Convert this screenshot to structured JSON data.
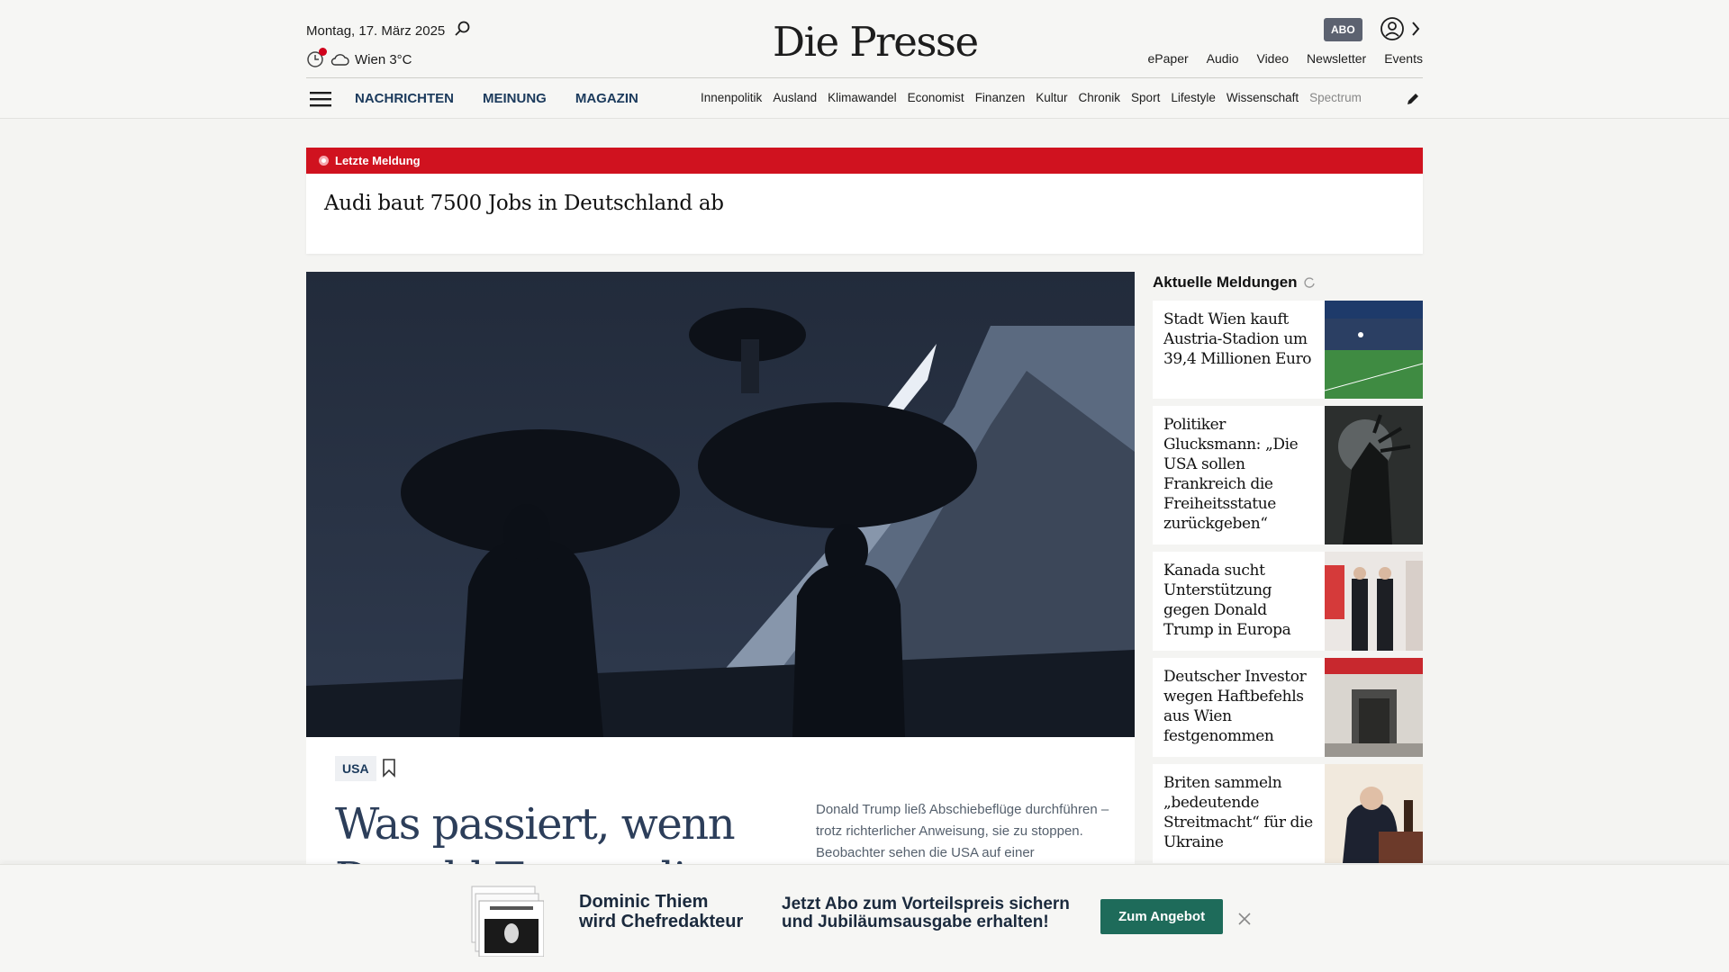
{
  "header": {
    "date": "Montag, 17. März 2025",
    "weather": "Wien 3°C",
    "logo": "Die Presse",
    "abo_label": "ABO",
    "top_links": [
      "ePaper",
      "Audio",
      "Video",
      "Newsletter",
      "Events"
    ],
    "main_nav": [
      "NACHRICHTEN",
      "MEINUNG",
      "MAGAZIN"
    ],
    "sub_nav": [
      "Innenpolitik",
      "Ausland",
      "Klimawandel",
      "Economist",
      "Finanzen",
      "Kultur",
      "Chronik",
      "Sport",
      "Lifestyle",
      "Wissenschaft",
      "Spectrum"
    ]
  },
  "breaking": {
    "label": "Letzte Meldung",
    "title": "Audi baut 7500 Jobs in Deutschland ab"
  },
  "hero": {
    "tag": "USA",
    "title": "Was passiert, wenn Donald Trump die",
    "teaser": "Donald Trump ließ Abschiebeflüge durchführen – trotz richterlicher Anweisung, sie zu stoppen. Beobachter sehen die USA auf einer"
  },
  "sidebar": {
    "heading": "Aktuelle Meldungen",
    "items": [
      {
        "title": "Stadt Wien kauft Austria-Stadion um 39,4 Millionen Euro"
      },
      {
        "title": "Politiker Glucksmann: „Die USA sollen Frankreich die Freiheitsstatue zurückgeben“"
      },
      {
        "title": "Kanada sucht Unterstützung gegen Donald Trump in Europa"
      },
      {
        "title": "Deutscher Investor wegen Haftbefehls aus Wien festgenommen"
      },
      {
        "title": "Briten sammeln „bedeutende Streitmacht“ für die Ukraine"
      }
    ]
  },
  "promo": {
    "name_line1": "Dominic Thiem",
    "name_line2": "wird Chefredakteur",
    "offer_line1": "Jetzt Abo zum Vorteilspreis sichern",
    "offer_line2": "und Jubiläumsausgabe erhalten!",
    "button": "Zum Angebot"
  },
  "colors": {
    "breaking_red": "#d0121f",
    "nav_blue": "#1b3a5c",
    "cta_green": "#1e6b5a"
  }
}
